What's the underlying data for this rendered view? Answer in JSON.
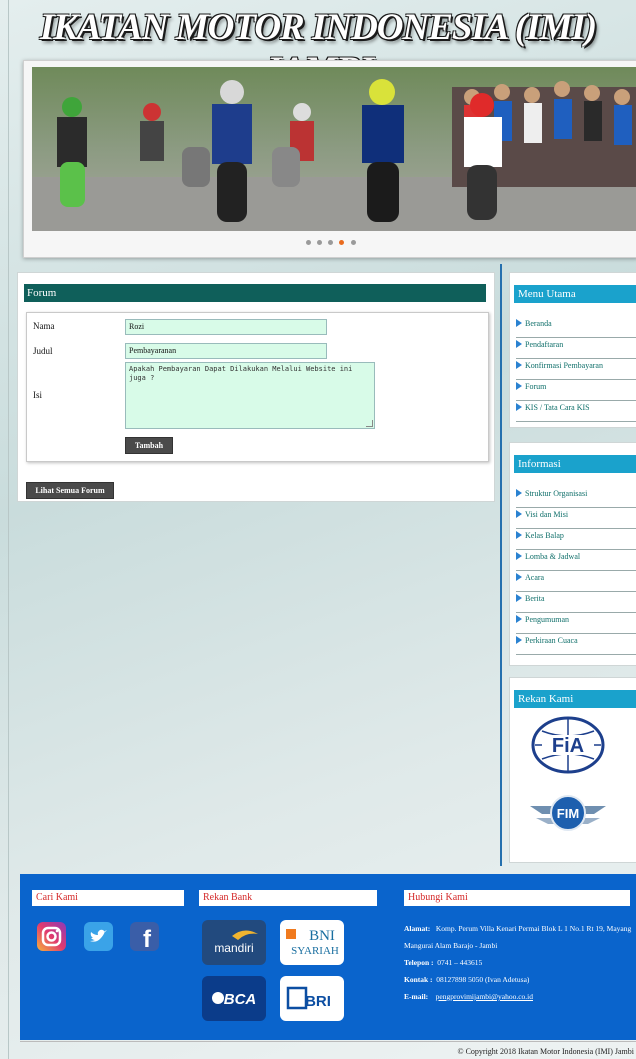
{
  "site": {
    "title": "IKATAN MOTOR INDONESIA (IMI) JAMBI"
  },
  "slider": {
    "dots": 5,
    "active_dot": 4
  },
  "forum": {
    "heading": "Forum",
    "fields": {
      "nama_label": "Nama",
      "nama_value": "Rozi",
      "judul_label": "Judul",
      "judul_value": "Pembayaranan",
      "isi_label": "Isi",
      "isi_value": "Apakah Pembayaran Dapat Dilakukan Melalui Website ini juga ?"
    },
    "submit_label": "Tambah",
    "all_forum_label": "Lihat Semua Forum"
  },
  "menu_utama": {
    "heading": "Menu Utama",
    "items": [
      "Beranda",
      "Pendaftaran",
      "Konfirmasi Pembayaran",
      "Forum",
      "KIS / Tata Cara KIS"
    ]
  },
  "informasi": {
    "heading": "Informasi",
    "items": [
      "Struktur Organisasi",
      "Visi dan Misi",
      "Kelas Balap",
      "Lomba & Jadwal",
      "Acara",
      "Berita",
      "Pengumuman",
      "Perkiraan Cuaca"
    ]
  },
  "rekan_kami": {
    "heading": "Rekan Kami",
    "logos": [
      "FiA",
      "FIM"
    ]
  },
  "footer": {
    "cari_kami": "Cari Kami",
    "social_icons": [
      "instagram-icon",
      "twitter-icon",
      "facebook-icon"
    ],
    "rekan_bank": "Rekan Bank",
    "banks": [
      "mandiri",
      "BNI SYARIAH",
      "BCA",
      "BRI"
    ],
    "hubungi_kami": "Hubungi Kami",
    "alamat_label": "Alamat:",
    "alamat": "Komp. Perum Villa Kenari Permai Blok L 1 No.1 Rt 19, Mayang Mangurai Alam Barajo - Jambi",
    "telepon_label": "Telepon :",
    "telepon": "0741 – 443615",
    "kontak_label": "Kontak :",
    "kontak": "08127898 5050 (Ivan Adetusa)",
    "email_label": "E-mail:",
    "email": "pengprovimijambi@yahoo.co.id"
  },
  "copyright": "© Copyright 2018 Ikatan Motor Indonesia (IMI) Jambi",
  "colors": {
    "forum_header": "#0f5f5a",
    "sidebar_header": "#1aa2cc",
    "footer_bg": "#0a64cc",
    "input_bg": "#d8fbe8",
    "active_dot": "#e96b1e"
  }
}
